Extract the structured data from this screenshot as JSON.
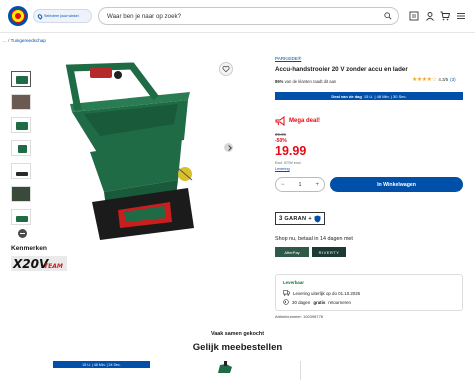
{
  "header": {
    "store_label": "Selecteer jouw winkel",
    "search_placeholder": "Waar ben je naar op zoek?",
    "icons": [
      "search-icon",
      "list-icon",
      "user-icon",
      "cart-icon",
      "menu-icon"
    ]
  },
  "breadcrumb": {
    "ellipsis": "... /",
    "current": "Tuingereedschap"
  },
  "product": {
    "brand": "PARKSIDE®",
    "title": "Accu-handstrooier 20 V zonder accu en lader",
    "rating_stars": "★★★★☆",
    "rating_value": "4.3/5",
    "rating_count": "(3)",
    "reviewers_pct": "86%",
    "reviewers_text": "van de klanten raadt dit aan",
    "deal_label": "Deal van de dag",
    "deal_timer": "15 U. | 48 Min. | 30 Sec."
  },
  "pricing": {
    "mega_label": "Mega deal!",
    "old_price": "39.99",
    "discount": "-50%",
    "price": "19.99",
    "vat_note": "Excl. BTW excl.",
    "levering": "Levering"
  },
  "cart": {
    "qty": "1",
    "minus": "−",
    "plus": "+",
    "button": "In Winkelwagen"
  },
  "garantie": {
    "years": "3",
    "label": "GARAN",
    "suffix": "+"
  },
  "payment": {
    "shop_nu": "Shop nu, betaal in 14 dagen met",
    "afterpay": "AfterPay",
    "riverty": "RIVERTY"
  },
  "delivery": {
    "title": "Leverbaar",
    "line1": "Levering uiterlijk op do 01.10.2026",
    "line2_pre": "30 dagen",
    "line2_bold": "gratis",
    "line2_post": "retourneren"
  },
  "article": "Artikelnummer: 100398778",
  "kenmerken": "Kenmerken",
  "brand_logo_text": "X20V TEAM",
  "recommend": {
    "subtitle": "Vaak samen gekocht",
    "title": "Gelijk meebestellen",
    "banner": "15 U. | 48 Min. | 24 Sec."
  },
  "colors": {
    "brand_blue": "#0050aa",
    "deal_red": "#e60a14",
    "product_green": "#1f6b45",
    "stars": "#f5a623"
  }
}
